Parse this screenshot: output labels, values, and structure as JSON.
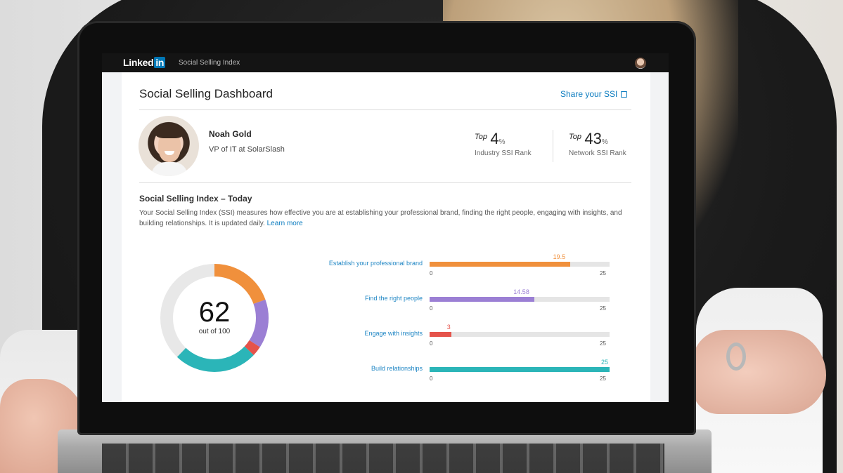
{
  "nav": {
    "logo_text": "Linked",
    "logo_in": "in",
    "page_title": "Social Selling Index"
  },
  "dashboard": {
    "title": "Social Selling Dashboard",
    "share_label": "Share your SSI"
  },
  "profile": {
    "name": "Noah Gold",
    "role": "VP of IT at SolarSlash"
  },
  "ranks": {
    "industry": {
      "prefix": "Top",
      "value": "4",
      "unit": "%",
      "label": "Industry SSI Rank"
    },
    "network": {
      "prefix": "Top",
      "value": "43",
      "unit": "%",
      "label": "Network SSI Rank"
    }
  },
  "ssi": {
    "heading": "Social Selling Index – Today",
    "description": "Your Social Selling Index (SSI) measures how effective you are at establishing your professional brand, finding the right people, engaging with insights, and building relationships. It is updated daily.",
    "learn_more": "Learn more",
    "score": "62",
    "score_sub": "out of 100"
  },
  "colors": {
    "brand": "#f0903c",
    "people": "#9b7fd4",
    "insights": "#e5534b",
    "relationships": "#2bb5b8",
    "track": "#e8e8e8",
    "link": "#0a7bbf"
  },
  "chart_data": {
    "type": "bar",
    "orientation": "horizontal",
    "total": 100,
    "score": 62,
    "categories": [
      "Establish your professional brand",
      "Find the right people",
      "Engage with insights",
      "Build relationships"
    ],
    "values": [
      19.5,
      14.58,
      3,
      25
    ],
    "value_labels": [
      "19.5",
      "14.58",
      "3",
      "25"
    ],
    "axis_min_label": "0",
    "axis_max_label": "25",
    "xlim": [
      0,
      25
    ]
  }
}
